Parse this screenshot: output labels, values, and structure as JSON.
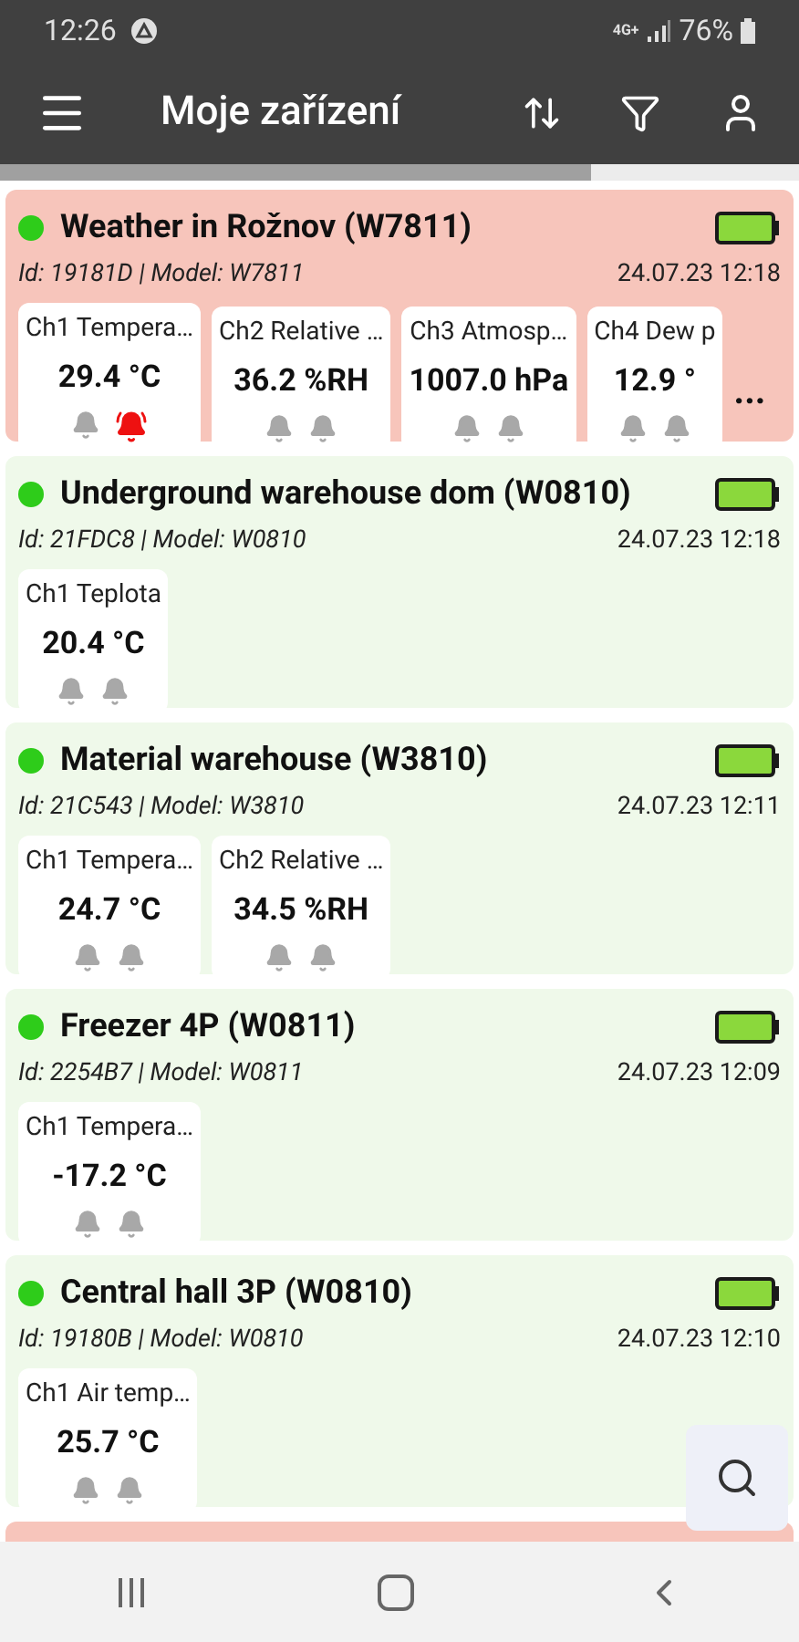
{
  "status_bar": {
    "time": "12:26",
    "network": "4G+",
    "battery": "76%"
  },
  "app_bar": {
    "title": "Moje zařízení"
  },
  "progress": {
    "level": 0.74
  },
  "devices": [
    {
      "title": "Weather in Rožnov (W7811)",
      "alert": true,
      "color": "#2ecc1a",
      "meta": "Id: 19181D | Model: W7811",
      "time": "24.07.23 12:18",
      "more": "...",
      "channels": [
        {
          "label": "Ch1 Tempera…",
          "value": "29.4 °C",
          "alarms": [
            {
              "active": false
            },
            {
              "active": true
            }
          ]
        },
        {
          "label": "Ch2 Relative …",
          "value": "36.2 %RH",
          "alarms": [
            {
              "active": false
            },
            {
              "active": false
            }
          ]
        },
        {
          "label": "Ch3 Atmosp…",
          "value": "1007.0 hPa",
          "alarms": [
            {
              "active": false
            },
            {
              "active": false
            }
          ]
        },
        {
          "label": "Ch4 Dew p",
          "value": "12.9 °",
          "alarms": [
            {
              "active": false
            },
            {
              "active": false
            }
          ]
        }
      ]
    },
    {
      "title": "Underground warehouse dom (W0810)",
      "alert": false,
      "color": "#2ecc1a",
      "meta": "Id: 21FDC8 | Model: W0810",
      "time": "24.07.23 12:18",
      "channels": [
        {
          "label": "Ch1 Teplota",
          "value": "20.4 °C",
          "alarms": [
            {
              "active": false
            },
            {
              "active": false
            }
          ]
        }
      ]
    },
    {
      "title": "Material warehouse (W3810)",
      "alert": false,
      "color": "#2ecc1a",
      "meta": "Id: 21C543 | Model: W3810",
      "time": "24.07.23 12:11",
      "channels": [
        {
          "label": "Ch1 Tempera…",
          "value": "24.7 °C",
          "alarms": [
            {
              "active": false
            },
            {
              "active": false
            }
          ]
        },
        {
          "label": "Ch2 Relative …",
          "value": "34.5 %RH",
          "alarms": [
            {
              "active": false
            },
            {
              "active": false
            }
          ]
        }
      ]
    },
    {
      "title": "Freezer 4P (W0811)",
      "alert": false,
      "color": "#2ecc1a",
      "meta": "Id: 2254B7 | Model: W0811",
      "time": "24.07.23 12:09",
      "channels": [
        {
          "label": "Ch1 Tempera…",
          "value": "-17.2 °C",
          "alarms": [
            {
              "active": false
            },
            {
              "active": false
            }
          ]
        }
      ]
    },
    {
      "title": "Central hall 3P (W0810)",
      "alert": false,
      "color": "#2ecc1a",
      "meta": "Id: 19180B | Model: W0810",
      "time": "24.07.23 12:10",
      "channels": [
        {
          "label": "Ch1 Air temp…",
          "value": "25.7 °C",
          "alarms": [
            {
              "active": false
            },
            {
              "active": false
            }
          ]
        }
      ]
    }
  ],
  "next_card": {
    "alert": true
  }
}
